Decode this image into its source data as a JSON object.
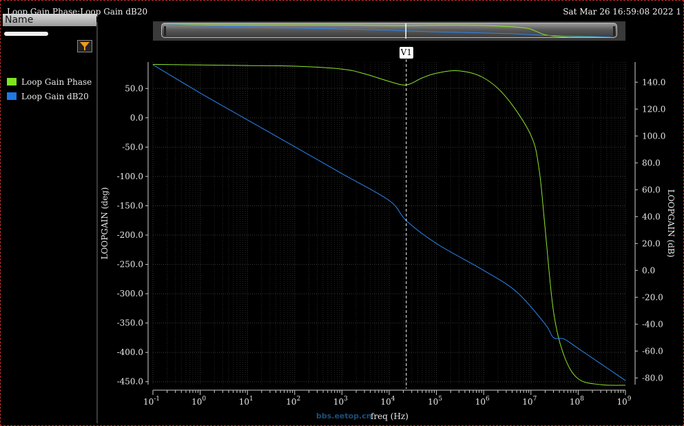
{
  "window": {
    "title": "Loop Gain Phase:Loop Gain dB20",
    "timestamp": "Sat Mar 26 16:59:08 2022   1"
  },
  "sidebar": {
    "header": "Name",
    "legend": [
      {
        "label": "Loop Gain Phase",
        "color": "#7ee61e"
      },
      {
        "label": "Loop Gain dB20",
        "color": "#1e78e6"
      }
    ]
  },
  "marker": {
    "label": "V1",
    "freq": 23000
  },
  "watermark": "bbs.eetop.cn",
  "chart_data": {
    "type": "line",
    "xlabel": "freq (Hz)",
    "xscale": "log",
    "xlim": [
      0.1,
      1000000000
    ],
    "x_ticks": [
      {
        "exp": -1
      },
      {
        "exp": 0
      },
      {
        "exp": 1
      },
      {
        "exp": 2
      },
      {
        "exp": 3
      },
      {
        "exp": 4
      },
      {
        "exp": 5
      },
      {
        "exp": 6
      },
      {
        "exp": 7
      },
      {
        "exp": 8
      },
      {
        "exp": 9
      }
    ],
    "y_left": {
      "label": "LOOPGAIN (deg)",
      "lim": [
        -455,
        95
      ],
      "ticks": [
        "50.0",
        "0.0",
        "-50.0",
        "-100.0",
        "-150.0",
        "-200.0",
        "-250.0",
        "-300.0",
        "-350.0",
        "-400.0",
        "-450.0"
      ]
    },
    "y_right": {
      "label": "LOOPGAIN (dB)",
      "lim": [
        -85,
        155
      ],
      "ticks": [
        "140.0",
        "120.0",
        "100.0",
        "80.0",
        "60.0",
        "40.0",
        "20.0",
        "0.0",
        "-20.0",
        "-40.0",
        "-60.0",
        "-80.0"
      ]
    },
    "grid": true,
    "series": [
      {
        "name": "Loop Gain Phase",
        "axis": "left",
        "color": "#8ee62a",
        "x": [
          0.1,
          1,
          10,
          100,
          1000,
          3000,
          10000,
          23000,
          50000,
          100000,
          300000,
          1000000,
          3000000,
          10000000,
          15000000,
          20000000,
          30000000,
          50000000,
          100000000,
          300000000,
          1000000000
        ],
        "y": [
          91,
          90,
          89,
          88,
          83,
          75,
          62,
          56,
          68,
          76,
          80,
          68,
          35,
          -30,
          -90,
          -190,
          -330,
          -405,
          -445,
          -455,
          -456
        ]
      },
      {
        "name": "Loop Gain dB20",
        "axis": "right",
        "color": "#2a86f0",
        "x": [
          0.1,
          1,
          10,
          100,
          1000,
          10000,
          23000,
          100000,
          1000000,
          5000000,
          20000000,
          30000000,
          50000000,
          100000000,
          1000000000
        ],
        "y": [
          153,
          132,
          112,
          92,
          72,
          52,
          37,
          20,
          0,
          -16,
          -40,
          -50,
          -51,
          -58,
          -82
        ]
      }
    ]
  }
}
